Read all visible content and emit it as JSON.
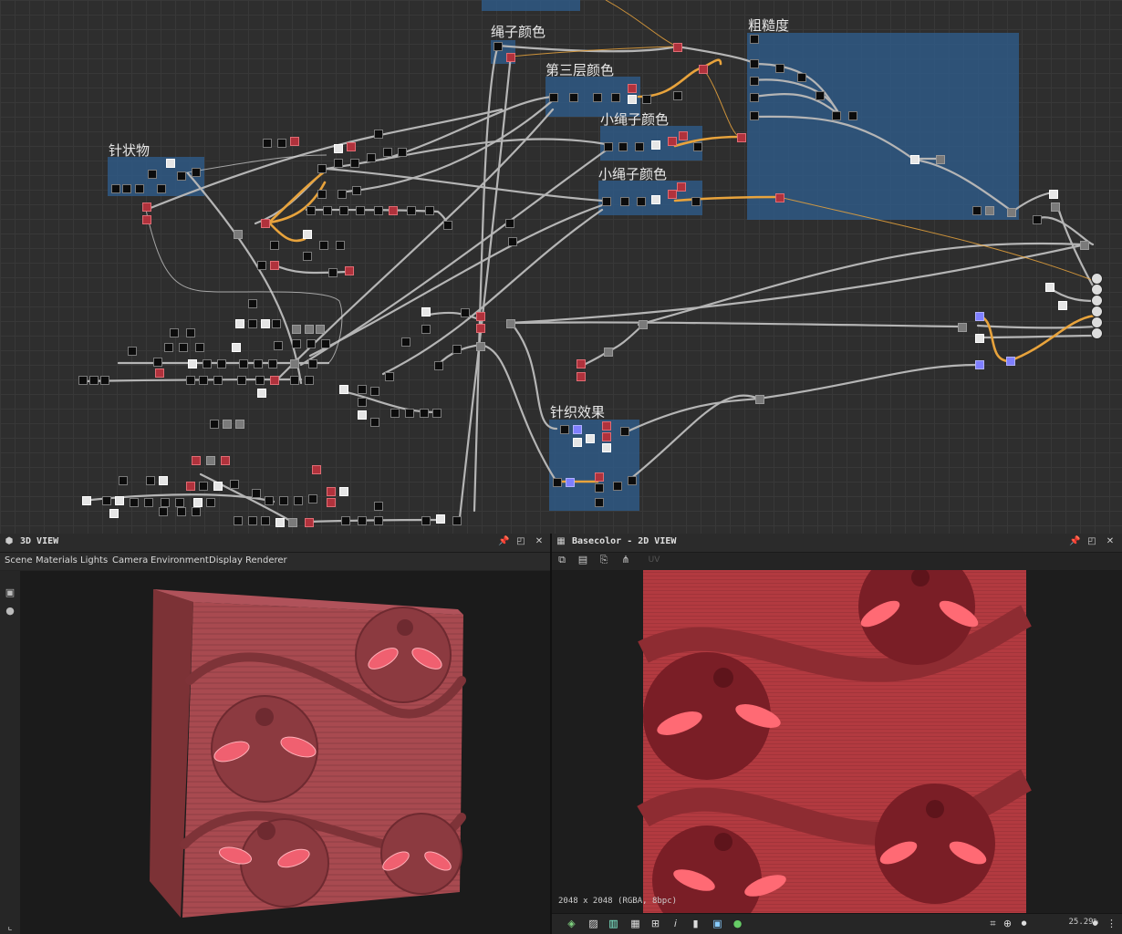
{
  "graph": {
    "frames": [
      {
        "id": "rope-color",
        "title": "绳子颜色"
      },
      {
        "id": "layer3-color",
        "title": "第三层颜色"
      },
      {
        "id": "small-rope-color-1",
        "title": "小绳子颜色"
      },
      {
        "id": "small-rope-color-2",
        "title": "小绳子颜色"
      },
      {
        "id": "roughness",
        "title": "粗糙度"
      },
      {
        "id": "needle",
        "title": "针状物"
      },
      {
        "id": "knit-effect",
        "title": "针织效果"
      }
    ]
  },
  "view3d": {
    "title": "3D VIEW",
    "menu": [
      "Scene",
      "Materials",
      "Lights",
      "Camera",
      "Environment",
      "Display",
      "Renderer"
    ],
    "side_icons": [
      "camera-icon",
      "light-icon"
    ],
    "material_color": "#a64a4f"
  },
  "view2d": {
    "title": "Basecolor - 2D VIEW",
    "uv_label": "UV",
    "resolution_info": "2048 x 2048 (RGBA, 8bpc)",
    "zoom": "25.29%",
    "texture_color": "#b23a40"
  },
  "colors": {
    "frame": "#2e5c8c",
    "wire": "#b5b5b5",
    "wire_orange": "#e8a33c",
    "node_red": "#b0323c"
  }
}
